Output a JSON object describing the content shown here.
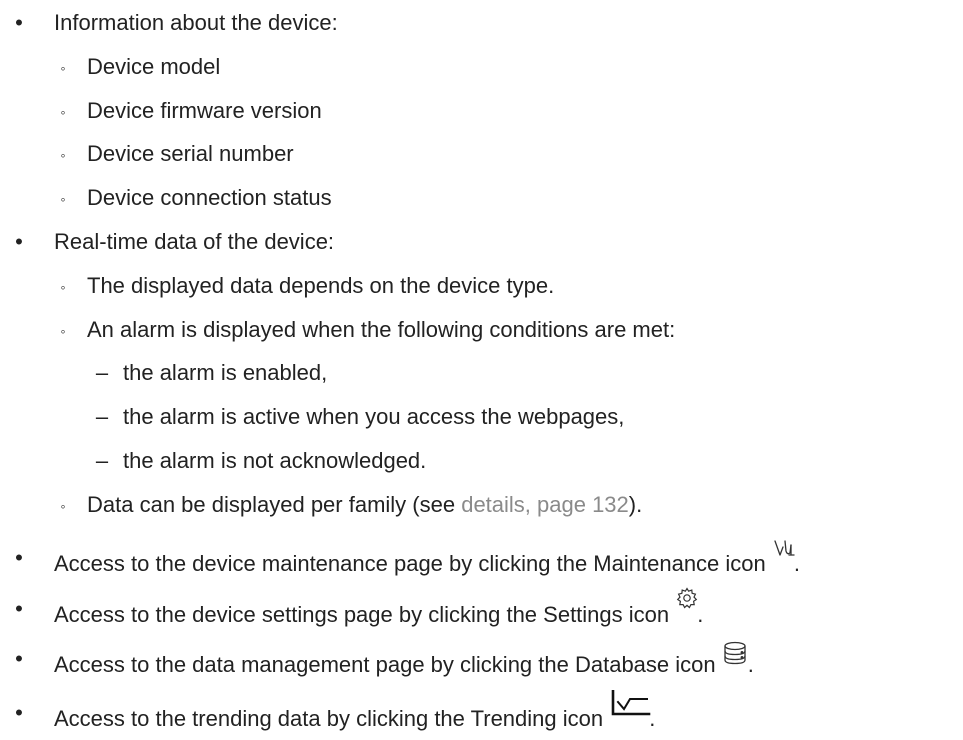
{
  "bullets": {
    "level1": "•",
    "level2": "◦",
    "level3": "–"
  },
  "info": {
    "heading": "Information about the device:",
    "items": [
      "Device model",
      "Device firmware version",
      "Device serial number",
      "Device connection status"
    ]
  },
  "realtime": {
    "heading": "Real-time data of the device:",
    "depends": "The displayed data depends on the device type.",
    "alarm_intro": "An alarm is displayed when the following conditions are met:",
    "conditions": [
      "the alarm is enabled,",
      "the alarm is active when you access the webpages,",
      "the alarm is not acknowledged."
    ],
    "family_prefix": "Data can be displayed per family (see ",
    "family_link": "details, page 132",
    "family_suffix": ")."
  },
  "access": [
    {
      "text": "Access to the device maintenance page by clicking the Maintenance icon ",
      "icon": "maintenance-stethoscope-icon"
    },
    {
      "text": "Access to the device settings page by clicking the Settings icon ",
      "icon": "settings-gear-icon"
    },
    {
      "text": "Access to the data management page by clicking the Database icon ",
      "icon": "database-icon"
    },
    {
      "text": "Access to the trending data by clicking the Trending icon ",
      "icon": "trending-chart-icon"
    }
  ],
  "period": ".",
  "colors": {
    "text": "#222222",
    "link": "#8a8a8a"
  }
}
